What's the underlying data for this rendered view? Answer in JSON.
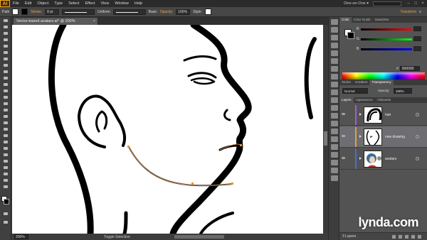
{
  "app": {
    "logo": "Ai"
  },
  "menu": {
    "items": [
      "File",
      "Edit",
      "Object",
      "Type",
      "Select",
      "Effect",
      "View",
      "Window",
      "Help"
    ],
    "workspace": "One-on-One ▾"
  },
  "controlbar": {
    "selection_label": "Path",
    "stroke_label": "Stroke:",
    "stroke_weight": "8 pt",
    "profile_label": "Uniform",
    "brush_label": "Basic",
    "opacity_label": "Opacity:",
    "opacity_value": "100%",
    "style_label": "Style:",
    "transform_label": "Transform"
  },
  "document": {
    "tab_title": "Vector-based avatars.ai* @ 200% (RGB/Preview)",
    "close_glyph": "×"
  },
  "status": {
    "zoom": "200%",
    "text": "Toggle Selection"
  },
  "color_panel": {
    "tabs": [
      "Color",
      "Color Guide",
      "Swatches"
    ],
    "sliders": [
      {
        "letter": "R",
        "value": "",
        "gradient": "linear-gradient(to right,#000,#ff0000)"
      },
      {
        "letter": "G",
        "value": "",
        "gradient": "linear-gradient(to right,#000,#00ff00)"
      },
      {
        "letter": "B",
        "value": "",
        "gradient": "linear-gradient(to right,#000,#0000ff)"
      }
    ],
    "hex_label": "#",
    "hex_value": "000000"
  },
  "transparency_panel": {
    "tabs": [
      "Stroke",
      "Gradient",
      "Transparency"
    ],
    "blend_mode": "Normal",
    "opacity_label": "Opacity:",
    "opacity_value": "100%"
  },
  "layers_panel": {
    "tabs": [
      "Layers",
      "Appearance",
      "Artboards"
    ],
    "layers": [
      {
        "name": "hair",
        "color": "#a35cd6",
        "selected": false
      },
      {
        "name": "new drawing",
        "color": "#e0a040",
        "selected": true
      },
      {
        "name": "avatars",
        "color": "#4a6fd1",
        "selected": false
      }
    ],
    "count": "3 Layers"
  },
  "watermark": {
    "text": "lynda",
    "suffix": ".com"
  }
}
